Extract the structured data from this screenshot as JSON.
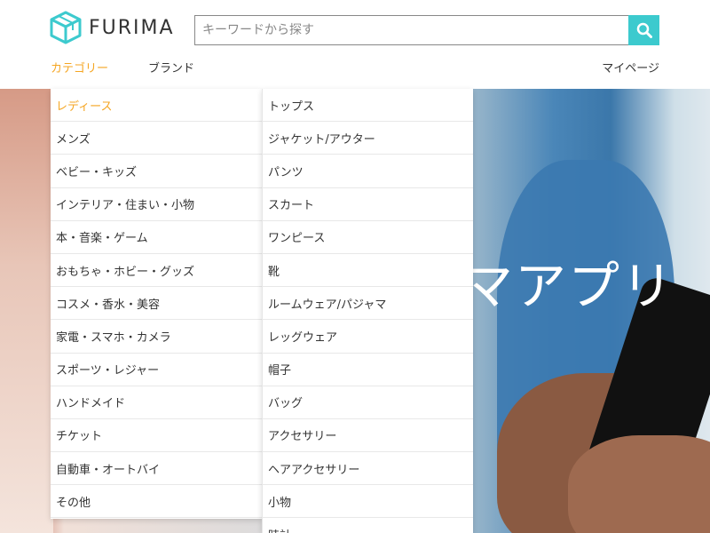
{
  "header": {
    "logo_text": "FURIMA",
    "search_placeholder": "キーワードから探す"
  },
  "nav": {
    "category": "カテゴリー",
    "brand": "ブランド",
    "mypage": "マイページ"
  },
  "hero": {
    "text": "マアプリ"
  },
  "categories": [
    "レディース",
    "メンズ",
    "ベビー・キッズ",
    "インテリア・住まい・小物",
    "本・音楽・ゲーム",
    "おもちゃ・ホビー・グッズ",
    "コスメ・香水・美容",
    "家電・スマホ・カメラ",
    "スポーツ・レジャー",
    "ハンドメイド",
    "チケット",
    "自動車・オートバイ",
    "その他"
  ],
  "subcategories": [
    "トップス",
    "ジャケット/アウター",
    "パンツ",
    "スカート",
    "ワンピース",
    "靴",
    "ルームウェア/パジャマ",
    "レッグウェア",
    "帽子",
    "バッグ",
    "アクセサリー",
    "ヘアアクセサリー",
    "小物",
    "時計"
  ],
  "colors": {
    "accent": "#f5a623",
    "search_button": "#3ccace",
    "logo": "#3ccace"
  },
  "icons": {
    "logo": "cube-logo-icon",
    "search": "search-icon"
  }
}
